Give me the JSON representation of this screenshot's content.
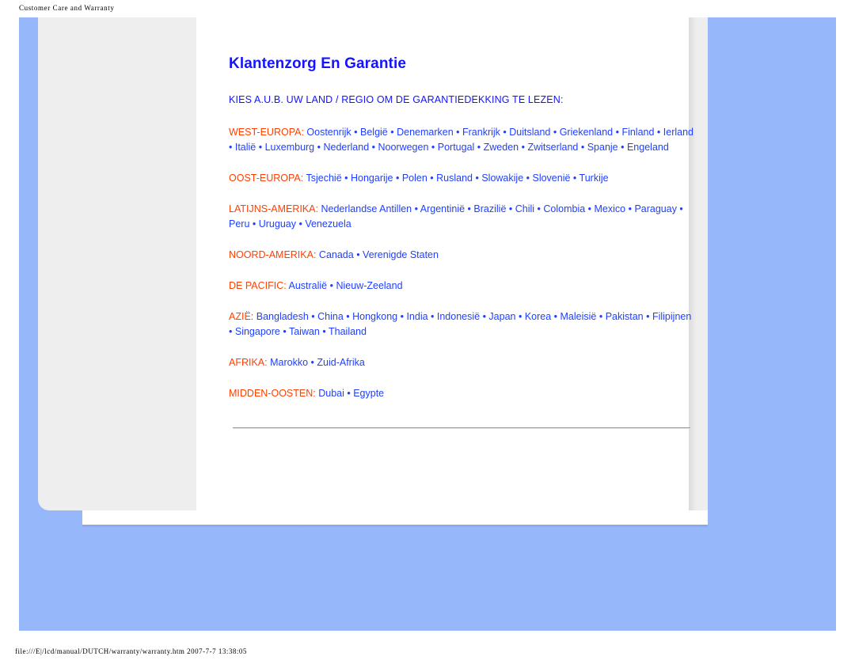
{
  "print": {
    "header": "Customer Care and Warranty",
    "footer": "file:///E|/lcd/manual/DUTCH/warranty/warranty.htm 2007-7-7 13:38:05"
  },
  "colors": {
    "page_background": "#96b8fb",
    "gutter": "#eeeeee",
    "content": "#ffffff",
    "title": "#1414ff",
    "region_label": "#ff4000",
    "link": "#1f3fff"
  },
  "document": {
    "title": "Klantenzorg En Garantie",
    "subtitle": "KIES A.U.B. UW LAND / REGIO OM DE GARANTIEDEKKING TE LEZEN:",
    "separator": "•",
    "regions": [
      {
        "label": "WEST-EUROPA:",
        "countries": [
          "Oostenrijk",
          "België",
          "Denemarken",
          "Frankrijk",
          "Duitsland",
          "Griekenland",
          "Finland",
          "Ierland",
          "Italië",
          "Luxemburg",
          "Nederland",
          "Noorwegen",
          "Portugal",
          "Zweden",
          "Zwitserland",
          "Spanje",
          "Engeland"
        ]
      },
      {
        "label": "OOST-EUROPA:",
        "countries": [
          "Tsjechië",
          "Hongarije",
          "Polen",
          "Rusland",
          "Slowakije",
          "Slovenië",
          "Turkije"
        ]
      },
      {
        "label": "LATIJNS-AMERIKA:",
        "countries": [
          "Nederlandse Antillen",
          "Argentinië",
          "Brazilië",
          "Chili",
          "Colombia",
          "Mexico",
          "Paraguay",
          "Peru",
          "Uruguay",
          "Venezuela"
        ]
      },
      {
        "label": "NOORD-AMERIKA:",
        "countries": [
          "Canada",
          "Verenigde Staten"
        ]
      },
      {
        "label": "DE PACIFIC:",
        "countries": [
          "Australië",
          "Nieuw-Zeeland"
        ]
      },
      {
        "label": "AZIË:",
        "countries": [
          "Bangladesh",
          "China",
          "Hongkong",
          "India",
          "Indonesië",
          "Japan",
          "Korea",
          "Maleisië",
          "Pakistan",
          "Filipijnen",
          "Singapore",
          "Taiwan",
          "Thailand"
        ]
      },
      {
        "label": "AFRIKA:",
        "countries": [
          "Marokko",
          "Zuid-Afrika"
        ]
      },
      {
        "label": "MIDDEN-OOSTEN:",
        "countries": [
          "Dubai",
          "Egypte"
        ]
      }
    ]
  }
}
